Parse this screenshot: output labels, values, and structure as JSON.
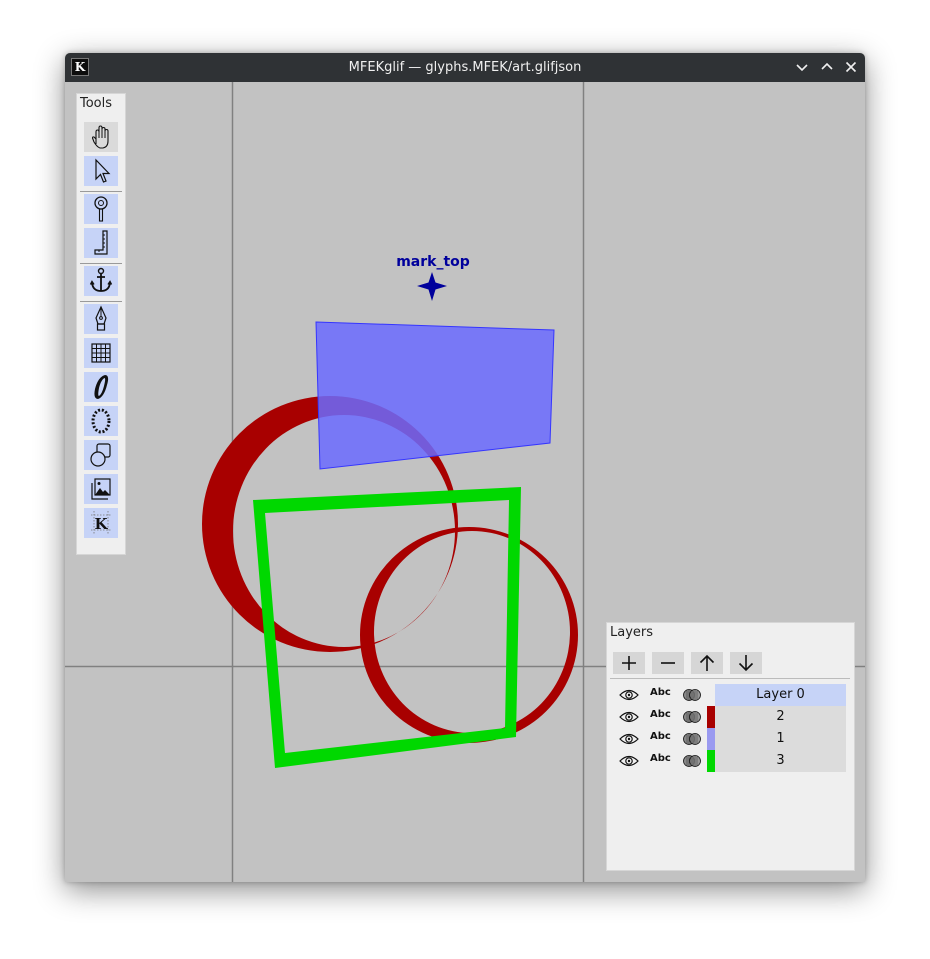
{
  "window": {
    "title": "MFEKglif — glyphs.MFEK/art.glifjson",
    "app_icon_letter": "K",
    "controls": [
      "minimize",
      "maximize",
      "close"
    ]
  },
  "canvas": {
    "background": "#c2c2c2",
    "guide_color": "#808080",
    "anchor": {
      "name": "mark_top",
      "color": "#00009c"
    },
    "shapes": [
      {
        "kind": "quadrilateral",
        "color": "#6b6bff",
        "opacity": 0.85,
        "layer": "1"
      },
      {
        "kind": "ring",
        "color": "#a80000",
        "layer": "2"
      },
      {
        "kind": "ring",
        "color": "#a80000",
        "layer": "2"
      },
      {
        "kind": "quadrilateral-outline",
        "color": "#00d800",
        "layer": "3"
      }
    ]
  },
  "tools": {
    "title": "Tools",
    "items": [
      {
        "name": "pan",
        "icon": "hand-icon",
        "active": true
      },
      {
        "name": "select",
        "icon": "pointer-icon",
        "active": false
      },
      {
        "name": "zoom",
        "icon": "magnifier-icon",
        "active": false
      },
      {
        "name": "measure",
        "icon": "ruler-icon",
        "active": false
      },
      {
        "name": "anchors",
        "icon": "anchor-icon",
        "active": false
      },
      {
        "name": "pen",
        "icon": "pen-nib-icon",
        "active": false
      },
      {
        "name": "grid",
        "icon": "grid-icon",
        "active": false
      },
      {
        "name": "vws",
        "icon": "variable-stroke-icon",
        "active": false
      },
      {
        "name": "pap",
        "icon": "pattern-along-path-icon",
        "active": false
      },
      {
        "name": "shapes",
        "icon": "shapes-icon",
        "active": false
      },
      {
        "name": "image",
        "icon": "image-icon",
        "active": false
      },
      {
        "name": "guidelines",
        "icon": "guidelines-icon",
        "active": false
      }
    ]
  },
  "layers": {
    "title": "Layers",
    "buttons": [
      {
        "name": "add",
        "icon": "plus-icon"
      },
      {
        "name": "remove",
        "icon": "minus-icon"
      },
      {
        "name": "move-up",
        "icon": "arrow-up-icon"
      },
      {
        "name": "move-down",
        "icon": "arrow-down-icon"
      }
    ],
    "abc_label": "Abc",
    "rows": [
      {
        "name": "Layer 0",
        "color": null,
        "selected": true
      },
      {
        "name": "2",
        "color": "#a80000",
        "selected": false
      },
      {
        "name": "1",
        "color": "#9a9af0",
        "selected": false
      },
      {
        "name": "3",
        "color": "#00d800",
        "selected": false
      }
    ]
  }
}
